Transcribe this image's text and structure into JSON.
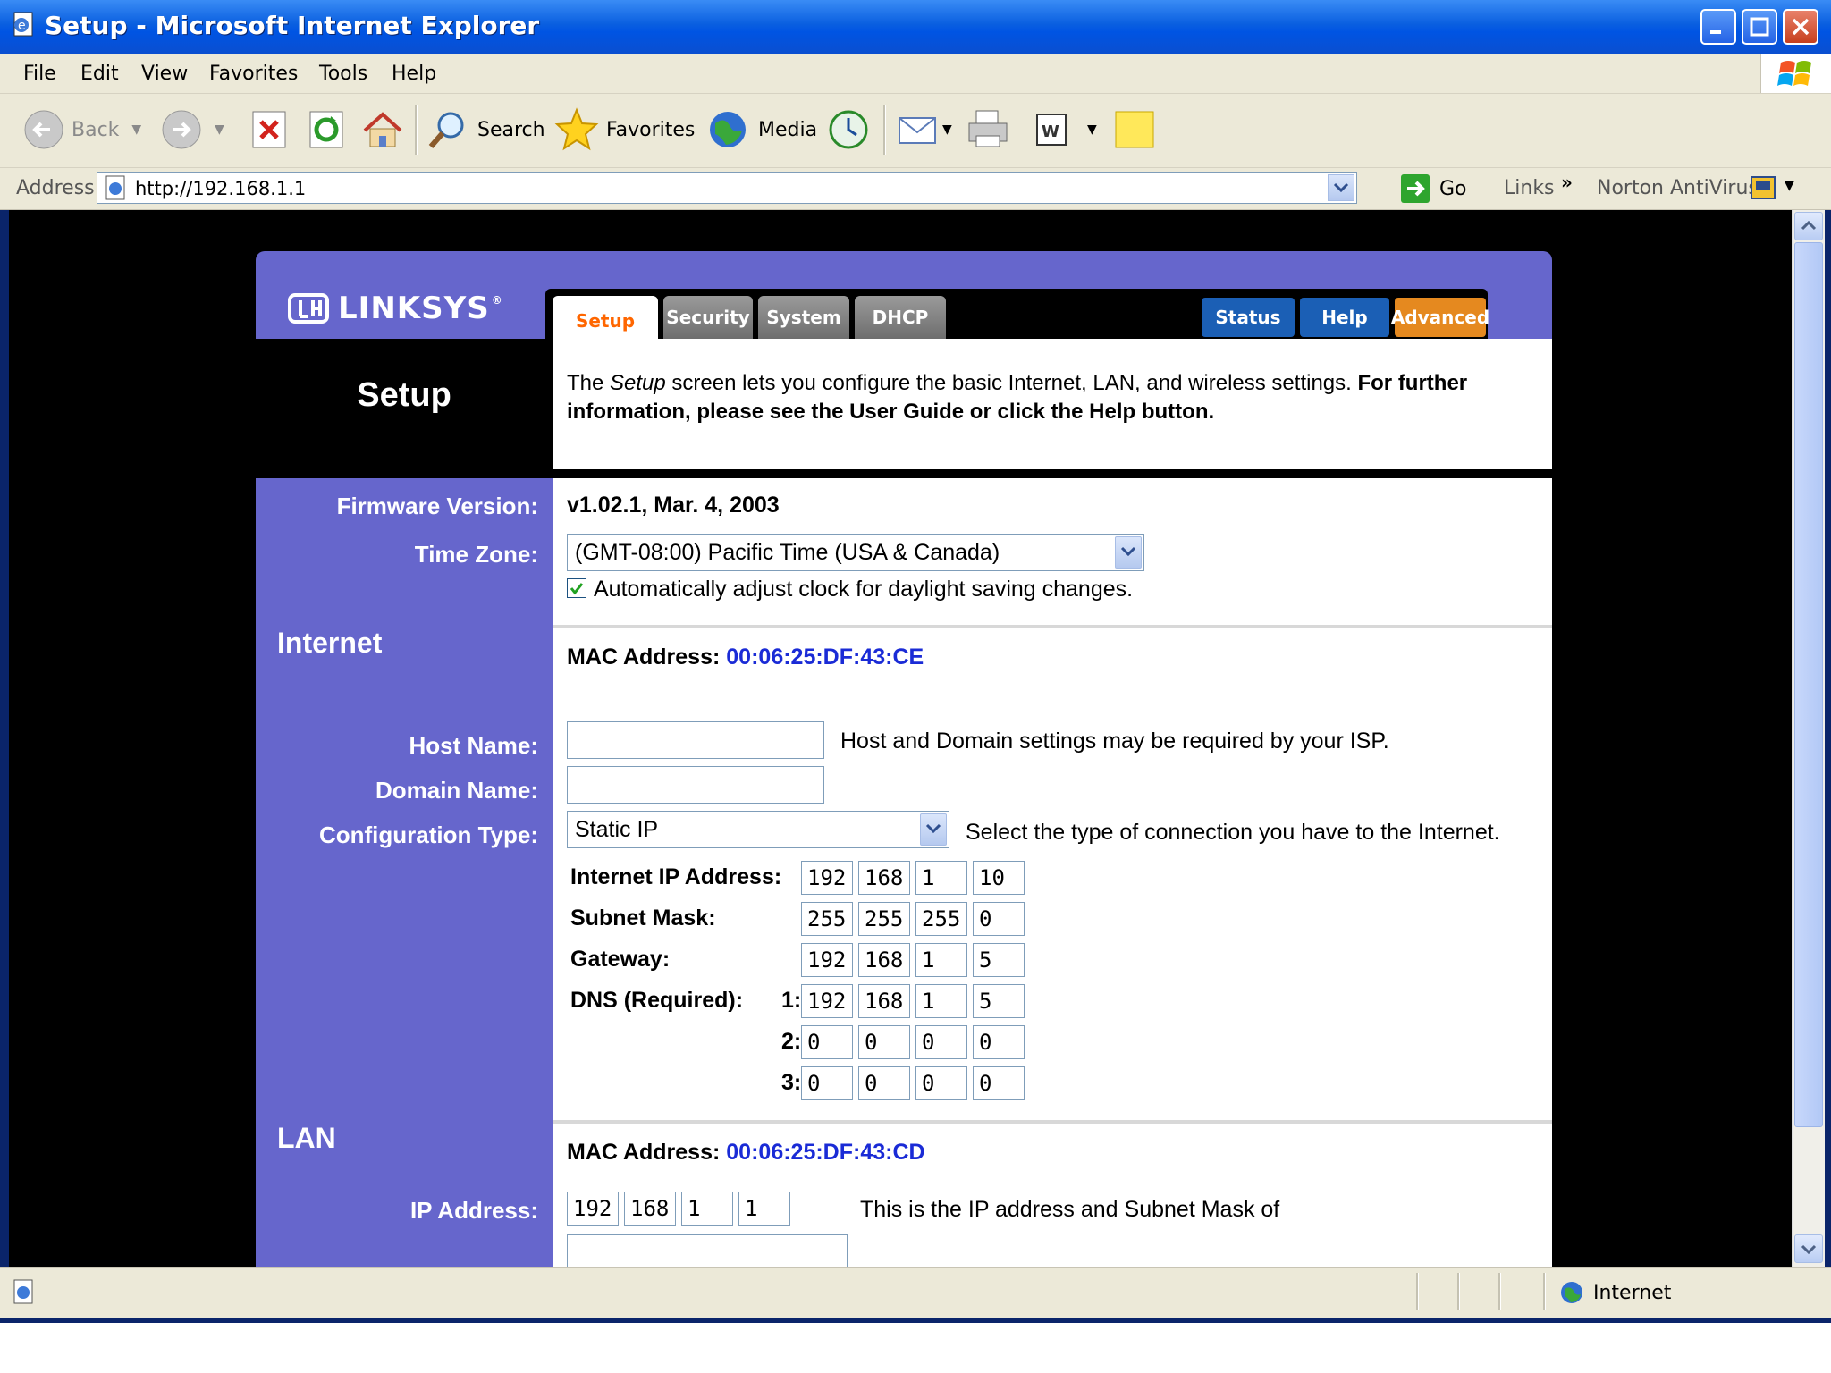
{
  "window": {
    "title": "Setup - Microsoft Internet Explorer"
  },
  "menu": [
    "File",
    "Edit",
    "View",
    "Favorites",
    "Tools",
    "Help"
  ],
  "toolbar": {
    "back": "Back",
    "search": "Search",
    "favorites": "Favorites",
    "media": "Media"
  },
  "address": {
    "label": "Address",
    "url": "http://192.168.1.1",
    "go": "Go",
    "links": "Links",
    "norton": "Norton AntiVirus"
  },
  "status": {
    "zone": "Internet"
  },
  "linksys": {
    "brand": "LINKSYS",
    "tabs": {
      "setup": "Setup",
      "security": "Security",
      "system": "System",
      "dhcp": "DHCP",
      "status": "Status",
      "help": "Help",
      "advanced": "Advanced"
    },
    "page_title": "Setup",
    "intro_pre": "The ",
    "intro_em": "Setup",
    "intro_mid": " screen lets you configure the basic Internet, LAN, and wireless settings. ",
    "intro_bold": "For further information, please see the User Guide or click the Help button.",
    "firmware_label": "Firmware Version:",
    "firmware_value": "v1.02.1, Mar. 4, 2003",
    "timezone_label": "Time Zone:",
    "timezone_value": "(GMT-08:00) Pacific Time (USA & Canada)",
    "dst_label": "Automatically adjust clock for daylight saving changes.",
    "dst_checked": true,
    "internet": {
      "section": "Internet",
      "mac_label": "MAC Address:",
      "mac": "00:06:25:DF:43:CE",
      "host_label": "Host Name:",
      "domain_label": "Domain Name:",
      "host_note": "Host and Domain settings may be required by your ISP.",
      "config_label": "Configuration Type:",
      "config_value": "Static IP",
      "config_note": "Select the type of connection you have to the Internet.",
      "ip_label": "Internet IP Address:",
      "ip": [
        "192",
        "168",
        "1",
        "10"
      ],
      "mask_label": "Subnet Mask:",
      "mask": [
        "255",
        "255",
        "255",
        "0"
      ],
      "gw_label": "Gateway:",
      "gw": [
        "192",
        "168",
        "1",
        "5"
      ],
      "dns_label": "DNS (Required):",
      "dns1_label": "1:",
      "dns1": [
        "192",
        "168",
        "1",
        "5"
      ],
      "dns2_label": "2:",
      "dns2": [
        "0",
        "0",
        "0",
        "0"
      ],
      "dns3_label": "3:",
      "dns3": [
        "0",
        "0",
        "0",
        "0"
      ]
    },
    "lan": {
      "section": "LAN",
      "mac_label": "MAC Address:",
      "mac": "00:06:25:DF:43:CD",
      "ip_label": "IP Address:",
      "ip": [
        "192",
        "168",
        "1",
        "1"
      ],
      "ip_note": "This is the IP address and Subnet Mask of"
    }
  }
}
